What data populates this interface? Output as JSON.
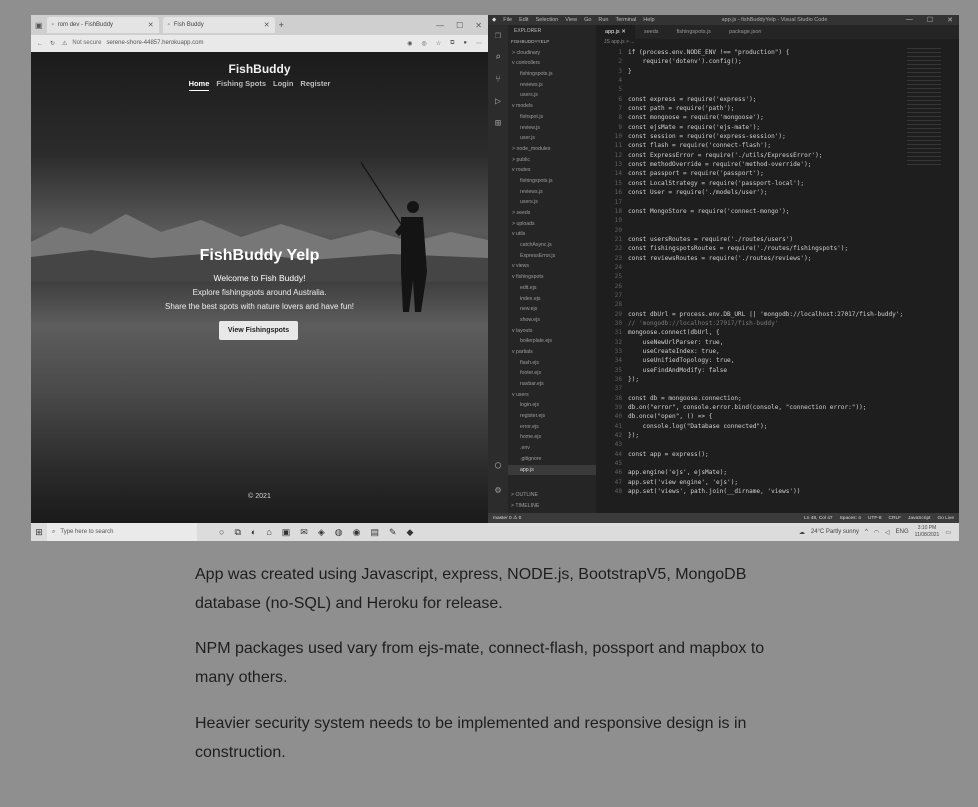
{
  "browser": {
    "tabs": [
      {
        "title": "rom dev - FishBuddy"
      },
      {
        "title": "Fish Buddy"
      }
    ],
    "new_tab": "+",
    "address": {
      "security": "Not secure",
      "url": "serene-shore-44857.herokuapp.com"
    }
  },
  "site": {
    "brand": "FishBuddy",
    "nav": [
      "Home",
      "Fishing Spots",
      "Login",
      "Register"
    ],
    "hero_title": "FishBuddy Yelp",
    "hero_subtitle": "Welcome to Fish Buddy!",
    "hero_line1": "Explore fishingspots around Australia.",
    "hero_line2": "Share the best spots with nature lovers and have fun!",
    "hero_button": "View Fishingspots",
    "footer": "© 2021"
  },
  "vscode": {
    "menu": [
      "File",
      "Edit",
      "Selection",
      "View",
      "Go",
      "Run",
      "Terminal",
      "Help"
    ],
    "window_title": "app.js - fishBuddyYelp - Visual Studio Code",
    "explorer_header": "EXPLORER",
    "project": "FISHBUDDYYELP",
    "tree": [
      "> cloudinary",
      "v controllers",
      "fishingspots.js",
      "reviews.js",
      "users.js",
      "v models",
      "fishspot.js",
      "review.js",
      "user.js",
      "> node_modules",
      "> public",
      "v routes",
      "fishingspots.js",
      "reviews.js",
      "users.js",
      "> seeds",
      "> uploads",
      "v utils",
      "catchAsync.js",
      "ExpressError.js",
      "v views",
      "v fishingspots",
      "edit.ejs",
      "index.ejs",
      "new.ejs",
      "show.ejs",
      "v layouts",
      "boilerplate.ejs",
      "v partials",
      "flash.ejs",
      "footer.ejs",
      "navbar.ejs",
      "v users",
      "login.ejs",
      "register.ejs",
      "error.ejs",
      "home.ejs",
      ".env",
      ".gitignore",
      "app.js"
    ],
    "outline": "> OUTLINE",
    "timeline": "> TIMELINE",
    "tabs": [
      "app.js",
      "seeds",
      "fishingspots.js",
      "package.json"
    ],
    "breadcrumb": "JS app.js > ...",
    "code": [
      {
        "n": "1",
        "t": "if (process.env.NODE_ENV !== \"production\") {"
      },
      {
        "n": "2",
        "t": "    require('dotenv').config();"
      },
      {
        "n": "3",
        "t": "}"
      },
      {
        "n": "4",
        "t": ""
      },
      {
        "n": "5",
        "t": ""
      },
      {
        "n": "6",
        "t": "const express = require('express');"
      },
      {
        "n": "7",
        "t": "const path = require('path');"
      },
      {
        "n": "8",
        "t": "const mongoose = require('mongoose');"
      },
      {
        "n": "9",
        "t": "const ejsMate = require('ejs-mate');"
      },
      {
        "n": "10",
        "t": "const session = require('express-session');"
      },
      {
        "n": "11",
        "t": "const flash = require('connect-flash');"
      },
      {
        "n": "12",
        "t": "const ExpressError = require('./utils/ExpressError');"
      },
      {
        "n": "13",
        "t": "const methodOverride = require('method-override');"
      },
      {
        "n": "14",
        "t": "const passport = require('passport');"
      },
      {
        "n": "15",
        "t": "const LocalStrategy = require('passport-local');"
      },
      {
        "n": "16",
        "t": "const User = require('./models/user');"
      },
      {
        "n": "17",
        "t": ""
      },
      {
        "n": "18",
        "t": "const MongoStore = require('connect-mongo');"
      },
      {
        "n": "19",
        "t": ""
      },
      {
        "n": "20",
        "t": ""
      },
      {
        "n": "21",
        "t": "const usersRoutes = require('./routes/users')"
      },
      {
        "n": "22",
        "t": "const fishingspotsRoutes = require('./routes/fishingspots');"
      },
      {
        "n": "23",
        "t": "const reviewsRoutes = require('./routes/reviews');"
      },
      {
        "n": "24",
        "t": ""
      },
      {
        "n": "25",
        "t": ""
      },
      {
        "n": "26",
        "t": ""
      },
      {
        "n": "27",
        "t": ""
      },
      {
        "n": "28",
        "t": ""
      },
      {
        "n": "29",
        "t": "const dbUrl = process.env.DB_URL || 'mongodb://localhost:27017/fish-buddy';"
      },
      {
        "n": "30",
        "t": "// 'mongodb://localhost:27017/fish-buddy'"
      },
      {
        "n": "31",
        "t": "mongoose.connect(dbUrl, {"
      },
      {
        "n": "32",
        "t": "    useNewUrlParser: true,"
      },
      {
        "n": "33",
        "t": "    useCreateIndex: true,"
      },
      {
        "n": "34",
        "t": "    useUnifiedTopology: true,"
      },
      {
        "n": "35",
        "t": "    useFindAndModify: false"
      },
      {
        "n": "36",
        "t": "});"
      },
      {
        "n": "37",
        "t": ""
      },
      {
        "n": "38",
        "t": "const db = mongoose.connection;"
      },
      {
        "n": "39",
        "t": "db.on(\"error\", console.error.bind(console, \"connection error:\"));"
      },
      {
        "n": "40",
        "t": "db.once(\"open\", () => {"
      },
      {
        "n": "41",
        "t": "    console.log(\"Database connected\");"
      },
      {
        "n": "42",
        "t": "});"
      },
      {
        "n": "43",
        "t": ""
      },
      {
        "n": "44",
        "t": "const app = express();"
      },
      {
        "n": "45",
        "t": ""
      },
      {
        "n": "46",
        "t": "app.engine('ejs', ejsMate);"
      },
      {
        "n": "47",
        "t": "app.set('view engine', 'ejs');"
      },
      {
        "n": "48",
        "t": "app.set('views', path.join(__dirname, 'views'))"
      }
    ],
    "status_left": "master  0 ⚠ 0",
    "status_right": [
      "Ln 48, Col 47",
      "Spaces: 4",
      "UTF-8",
      "CRLF",
      "JavaScript",
      "Go Live"
    ]
  },
  "taskbar": {
    "search_placeholder": "Type here to search",
    "weather": "24°C  Partly sunny",
    "lang": "ENG",
    "time": "3:10 PM",
    "date": "11/08/2021"
  },
  "description": [
    "App was created using Javascript, express, NODE.js, BootstrapV5, MongoDB database (no-SQL) and Heroku for release.",
    "NPM packages used vary from ejs-mate, connect-flash, possport and mapbox to many others.",
    "Heavier security system needs to be implemented and responsive design is in construction."
  ]
}
